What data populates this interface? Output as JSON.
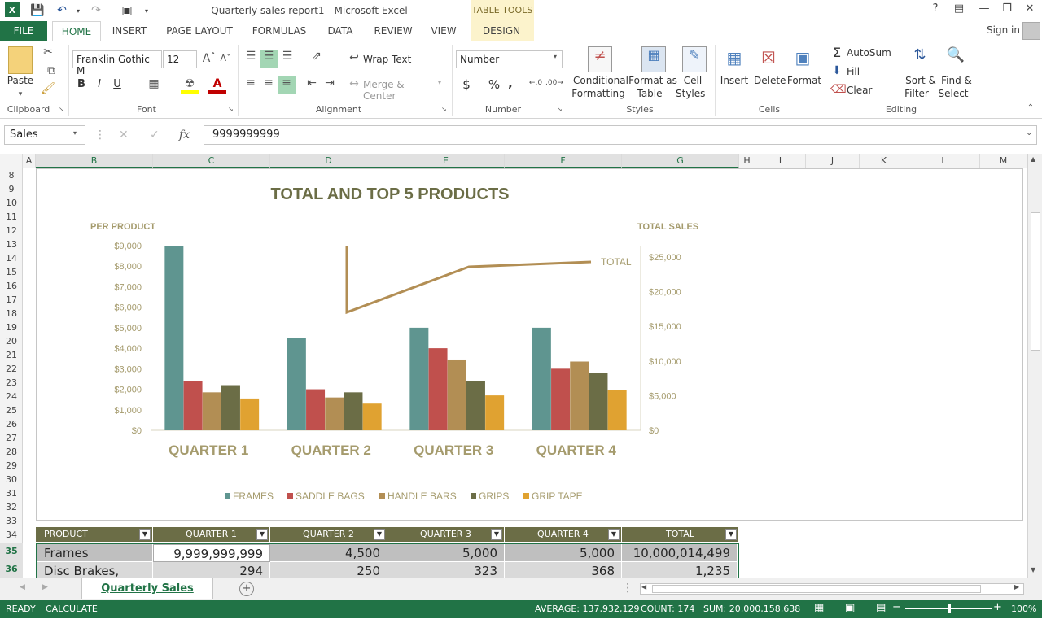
{
  "window": {
    "title": "Quarterly sales report1 - Microsoft Excel",
    "context_tab_group": "TABLE TOOLS",
    "help": "?",
    "sign_in": "Sign in"
  },
  "ribbon_tabs": [
    "FILE",
    "HOME",
    "INSERT",
    "PAGE LAYOUT",
    "FORMULAS",
    "DATA",
    "REVIEW",
    "VIEW",
    "DESIGN"
  ],
  "ribbon": {
    "clipboard": {
      "paste": "Paste",
      "label": "Clipboard"
    },
    "font": {
      "name": "Franklin Gothic M",
      "size": "12",
      "bold": "B",
      "italic": "I",
      "underline": "U",
      "label": "Font"
    },
    "alignment": {
      "wrap_text": "Wrap Text",
      "merge_center": "Merge & Center",
      "label": "Alignment"
    },
    "number": {
      "format": "Number",
      "currency": "$",
      "percent": "%",
      "comma": ",",
      "label": "Number"
    },
    "styles": {
      "conditional": "Conditional",
      "formatting": "Formatting",
      "format_as": "Format as",
      "table": "Table",
      "cell": "Cell",
      "styles": "Styles",
      "label": "Styles"
    },
    "cells": {
      "insert": "Insert",
      "delete": "Delete",
      "format": "Format",
      "label": "Cells"
    },
    "editing": {
      "autosum": "AutoSum",
      "fill": "Fill",
      "clear": "Clear",
      "sort": "Sort &",
      "filter": "Filter",
      "find": "Find &",
      "select": "Select",
      "label": "Editing"
    }
  },
  "formula_bar": {
    "name_box": "Sales",
    "fx": "fx",
    "value": "9999999999"
  },
  "columns": [
    "A",
    "B",
    "C",
    "D",
    "E",
    "F",
    "G",
    "H",
    "I",
    "J",
    "K",
    "L",
    "M"
  ],
  "rows": [
    "8",
    "9",
    "10",
    "11",
    "12",
    "13",
    "14",
    "15",
    "16",
    "17",
    "18",
    "19",
    "20",
    "21",
    "22",
    "23",
    "24",
    "25",
    "26",
    "27",
    "28",
    "29",
    "30",
    "31",
    "32",
    "33",
    "34",
    "35",
    "36"
  ],
  "chart_data": {
    "type": "bar",
    "title": "TOTAL AND TOP 5 PRODUCTS",
    "ylabel": "PER PRODUCT",
    "y2label": "TOTAL SALES",
    "ylim": [
      0,
      9000
    ],
    "y2lim": [
      0,
      25000
    ],
    "y_ticks": [
      "$9,000",
      "$8,000",
      "$7,000",
      "$6,000",
      "$5,000",
      "$4,000",
      "$3,000",
      "$2,000",
      "$1,000",
      "$0"
    ],
    "y2_ticks": [
      "$25,000",
      "$20,000",
      "$15,000",
      "$10,000",
      "$5,000",
      "$0"
    ],
    "categories": [
      "QUARTER 1",
      "QUARTER 2",
      "QUARTER 3",
      "QUARTER 4"
    ],
    "series": [
      {
        "name": "FRAMES",
        "color": "#5f9590",
        "values": [
          9000,
          4500,
          5000,
          5000
        ]
      },
      {
        "name": "SADDLE BAGS",
        "color": "#c0504d",
        "values": [
          2400,
          2000,
          4000,
          3000
        ]
      },
      {
        "name": "HANDLE BARS",
        "color": "#b28e54",
        "values": [
          1850,
          1600,
          3450,
          3350
        ]
      },
      {
        "name": "GRIPS",
        "color": "#6b6d46",
        "values": [
          2200,
          1850,
          2400,
          2800
        ]
      },
      {
        "name": "GRIP TAPE",
        "color": "#e0a231",
        "values": [
          1550,
          1300,
          1700,
          1950
        ]
      }
    ],
    "line_series": {
      "name": "TOTAL",
      "color": "#b28e54",
      "values": [
        25000,
        16800,
        23500,
        24200
      ]
    },
    "legend": "bottom",
    "grid": false
  },
  "table": {
    "headers": [
      "PRODUCT",
      "QUARTER 1",
      "QUARTER 2",
      "QUARTER 3",
      "QUARTER 4",
      "TOTAL"
    ],
    "rows": [
      [
        "Frames",
        "9,999,999,999",
        "4,500",
        "5,000",
        "5,000",
        "10,000,014,499"
      ],
      [
        "Disc Brakes, Front",
        "294",
        "250",
        "323",
        "368",
        "1,235"
      ]
    ]
  },
  "sheet_tab": "Quarterly Sales Report",
  "status": {
    "ready": "READY",
    "calculate": "CALCULATE",
    "average": "AVERAGE: 137,932,129",
    "count": "COUNT: 174",
    "sum": "SUM: 20,000,158,638",
    "zoom": "100%"
  },
  "colors": {
    "accent": "#217346",
    "table_header": "#6b6d46",
    "chart_text": "#a59b6d"
  }
}
